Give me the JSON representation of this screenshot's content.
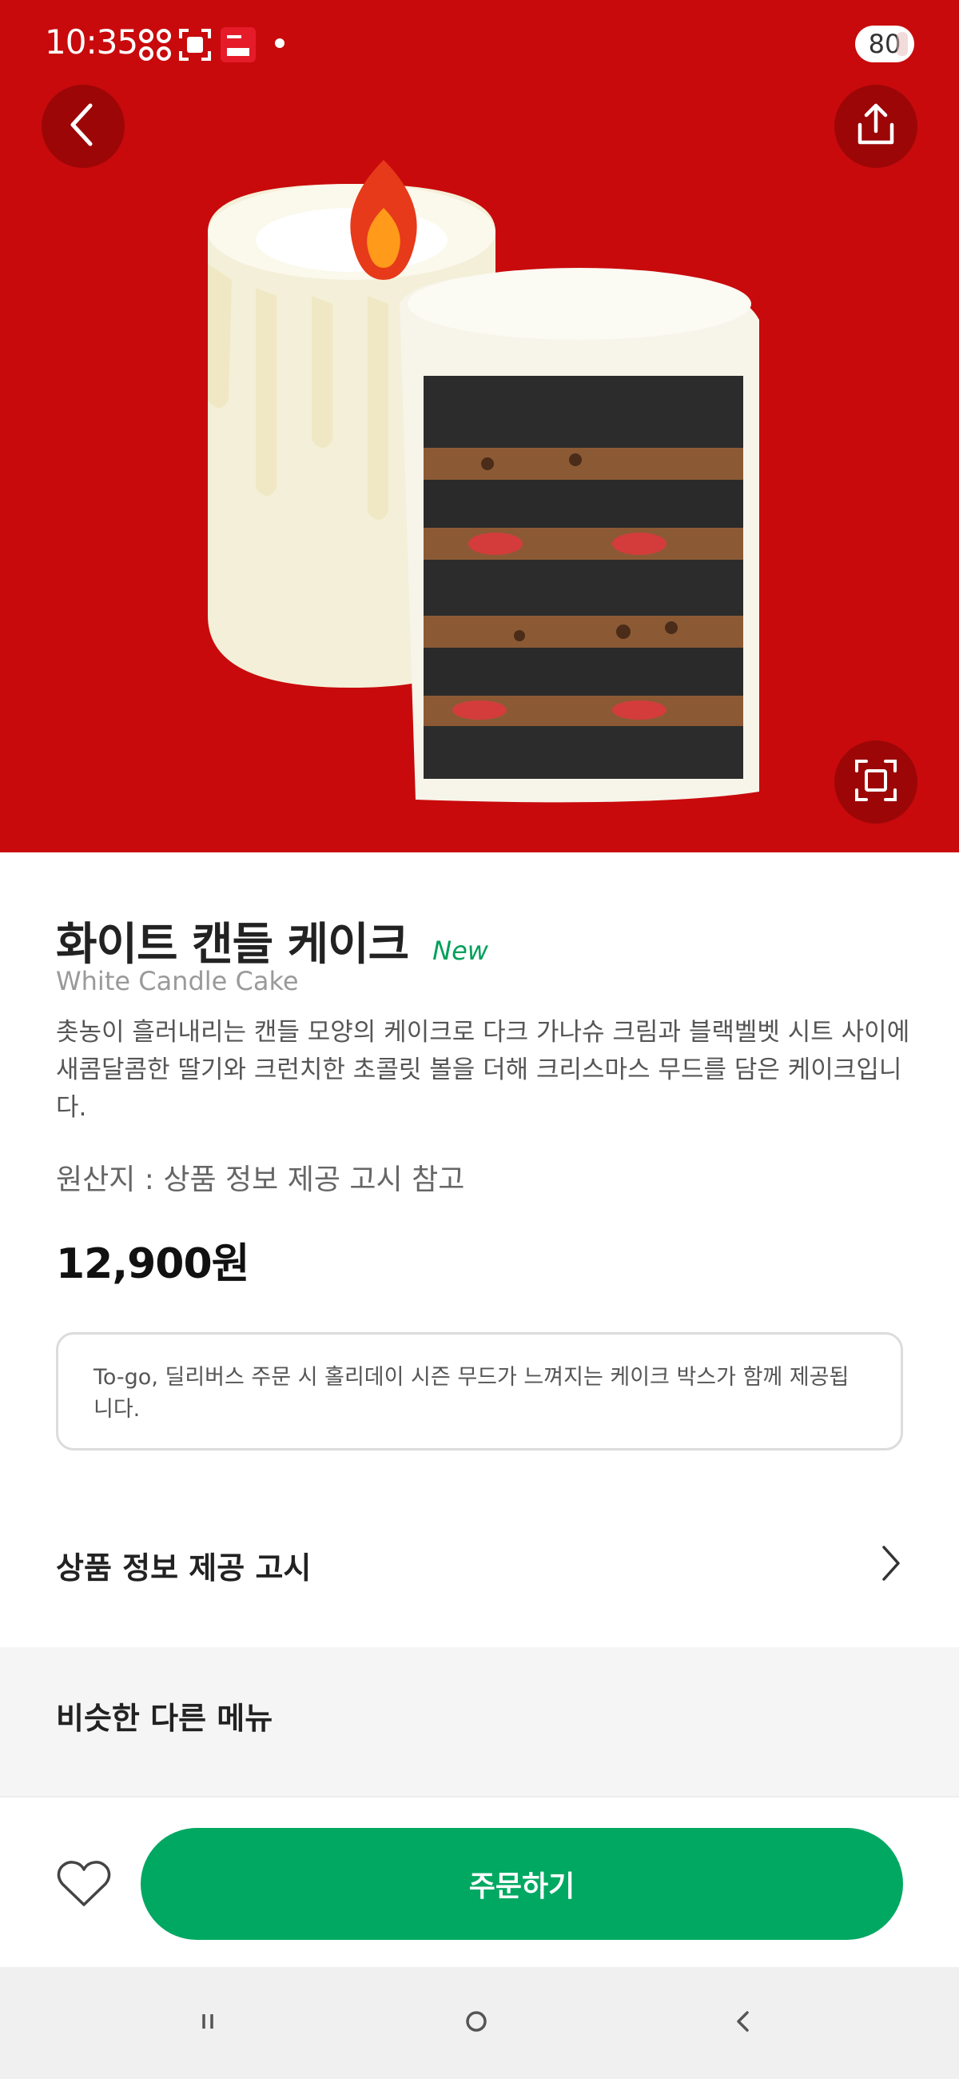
{
  "status_bar": {
    "time": "10:35",
    "icons": [
      "app-grid-icon",
      "screenshot-icon",
      "membership-card-icon"
    ],
    "battery": "80"
  },
  "hero": {
    "background_color": "#c80a0c",
    "back_icon": "chevron-left-icon",
    "share_icon": "share-icon",
    "zoom_icon": "expand-icon"
  },
  "product": {
    "name_ko": "화이트 캔들 케이크",
    "badge": "New",
    "name_en": "White Candle Cake",
    "description": "촛농이 흘러내리는 캔들 모양의 케이크로 다크 가나슈 크림과 블랙벨벳 시트 사이에 새콤달콤한 딸기와 크런치한 초콜릿 볼을 더해 크리스마스 무드를 담은 케이크입니다.",
    "origin": "원산지 : 상품 정보 제공 고시 참고",
    "price": "12,900원"
  },
  "notice": {
    "text": "To-go, 딜리버스 주문 시 홀리데이 시즌 무드가 느껴지는 케이크 박스가 함께 제공됩니다."
  },
  "info_section": {
    "label": "상품 정보 제공 고시"
  },
  "similar_section": {
    "title": "비슷한 다른 메뉴"
  },
  "order_bar": {
    "order_label": "주문하기",
    "accent_color": "#00a862"
  },
  "nav_bar": {
    "icons": [
      "recent-apps-icon",
      "home-icon",
      "back-icon"
    ]
  }
}
